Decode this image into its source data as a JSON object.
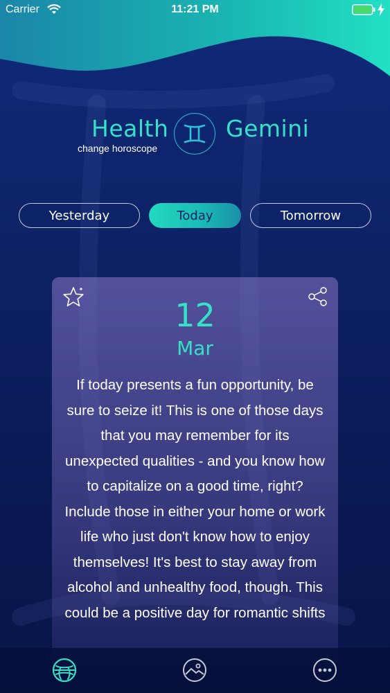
{
  "status_bar": {
    "carrier": "Carrier",
    "time": "11:21 PM",
    "wifi_icon": "wifi-icon",
    "battery_icon": "battery-icon",
    "charge_icon": "lightning-icon",
    "battery_color": "#4cd964"
  },
  "header": {
    "category": "Health",
    "change_link": "change horoscope",
    "sign": "Gemini",
    "sign_icon": "gemini-sign-icon"
  },
  "day_tabs": {
    "yesterday": "Yesterday",
    "today": "Today",
    "tomorrow": "Tomorrow",
    "selected": "today"
  },
  "card": {
    "day": "12",
    "month": "Mar",
    "favorite_icon": "star-icon",
    "share_icon": "share-icon",
    "text": "If today presents a fun opportunity, be sure to seize it! This is one of those days that you may remember for its unexpected qualities - and you know how to capitalize on a good time, right? Include those in either your home or work life who just don't know how to enjoy themselves! It's best to stay away from alcohol and unhealthy food, though. This could be a positive day for romantic shifts"
  },
  "tab_bar": {
    "items": [
      {
        "icon": "horoscope-globe-icon",
        "active": true
      },
      {
        "icon": "image-icon",
        "active": false
      },
      {
        "icon": "more-icon",
        "active": false
      }
    ]
  },
  "colors": {
    "accent": "#35e2c8",
    "background": "#0d2266",
    "text": "#ffffff"
  }
}
